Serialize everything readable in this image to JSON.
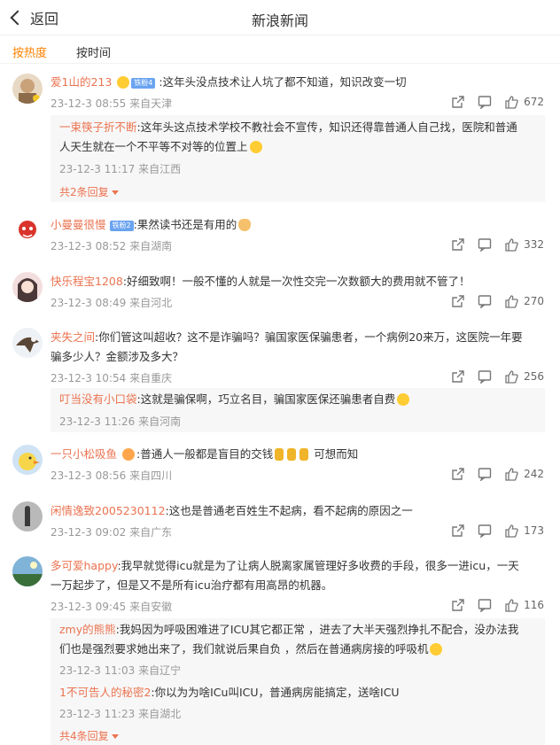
{
  "header": {
    "back_label": "返回",
    "title": "新浪新闻"
  },
  "tabs": [
    {
      "label": "按热度",
      "active": true
    },
    {
      "label": "按时间",
      "active": false
    }
  ],
  "colors": {
    "accent": "#ff8200",
    "username": "#eb7350",
    "meta": "#999999",
    "reply_bg": "#f7f7f7"
  },
  "comments": [
    {
      "user": "爱1山的213",
      "badge": "铁粉4",
      "lines": [
        ":这年头没点技术让人坑了都不知道，知识改变一切"
      ],
      "time": "23-12-3 08:55",
      "location": "来自天津",
      "likes": "672",
      "replies": [
        {
          "user": "一束筷子折不断",
          "lines": [
            ":这年头这点技术学校不教社会不宣传，知识还得靠普通人自己找，医院和普通",
            "人天生就在一个不平等不对等的位置上"
          ],
          "time": "23-12-3 11:17",
          "location": "来自江西"
        }
      ],
      "more_replies": "共2条回复"
    },
    {
      "user": "小曼曼很慢",
      "badge": "铁粉2",
      "lines": [
        ":果然读书还是有用的"
      ],
      "time": "23-12-3 08:52",
      "location": "来自湖南",
      "likes": "332"
    },
    {
      "user": "快乐程宝1208",
      "lines": [
        ":好细致啊！一般不懂的人就是一次性交完一次数额大的费用就不管了！"
      ],
      "time": "23-12-3 08:49",
      "location": "来自河北",
      "likes": "270"
    },
    {
      "user": "夹失之间",
      "lines": [
        ":你们管这叫超收？这不是诈骗吗？骗国家医保骗患者，一个病例20来万，这医院一年要",
        "骗多少人？金额涉及多大？"
      ],
      "time": "23-12-3 10:54",
      "location": "来自重庆",
      "likes": "256",
      "replies": [
        {
          "user": "叮当没有小口袋",
          "lines": [
            ":这就是骗保啊，巧立名目，骗国家医保还骗患者自费"
          ],
          "time": "23-12-3 11:26",
          "location": "来自河南"
        }
      ]
    },
    {
      "user": "一只小松吸鱼",
      "lines": [
        ":普通人一般都是盲目的交钱",
        " 可想而知"
      ],
      "time": "23-12-3 08:56",
      "location": "来自四川",
      "likes": "242"
    },
    {
      "user": "闲情逸致2005230112",
      "lines": [
        ":这也是普通老百姓生不起病，看不起病的原因之一"
      ],
      "time": "23-12-3 09:02",
      "location": "来自广东",
      "likes": "173"
    },
    {
      "user": "多可爱happy",
      "lines": [
        ":我早就觉得icu就是为了让病人脱离家属管理好多收费的手段，很多一进icu，一天",
        "一万起步了，但是又不是所有icu治疗都有用高昂的机器。"
      ],
      "time": "23-12-3 09:45",
      "location": "来自安徽",
      "likes": "116",
      "replies": [
        {
          "user": "zmy的熊熊",
          "lines": [
            ":我妈因为呼吸困难进了ICU其它都正常 ，进去了大半天强烈挣扎不配合，没办法我",
            "们也是强烈要求她出来了，我们就说后果自负 ，然后在普通病房接的呼吸机"
          ],
          "time": "23-12-3 11:03",
          "location": "来自辽宁"
        },
        {
          "user": "1不可告人的秘密2",
          "lines": [
            ":你以为为啥ICu叫ICU，普通病房能搞定，送啥ICU"
          ],
          "time": "23-12-3 11:23",
          "location": "来自湖北"
        }
      ],
      "more_replies": "共4条回复"
    }
  ]
}
